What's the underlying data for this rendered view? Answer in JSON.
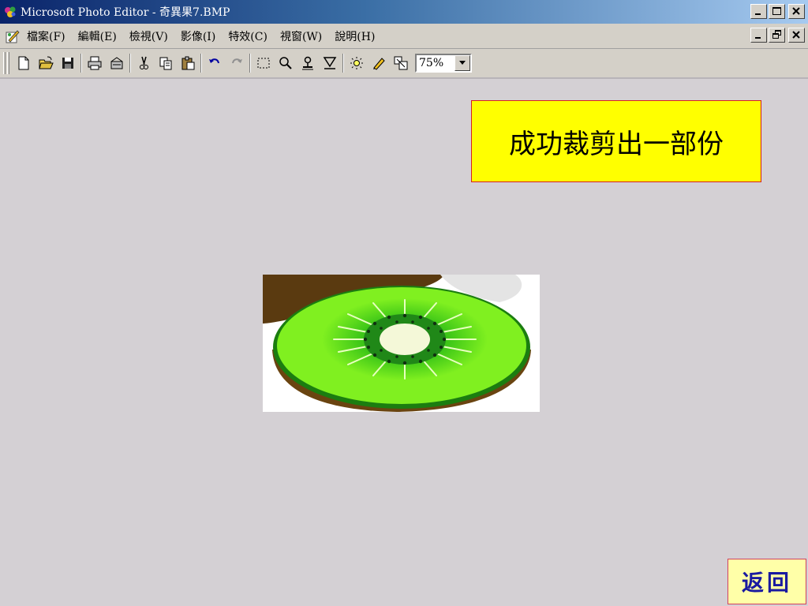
{
  "window": {
    "title": "Microsoft Photo Editor - 奇異果7.BMP"
  },
  "menu": {
    "items": [
      "檔案(F)",
      "編輯(E)",
      "檢視(V)",
      "影像(I)",
      "特效(C)",
      "視窗(W)",
      "說明(H)"
    ]
  },
  "toolbar": {
    "zoom_value": "75%"
  },
  "annotation": {
    "text": "成功裁剪出一部份"
  },
  "nav": {
    "back_label": "返回"
  },
  "colors": {
    "workspace": "#d4d0d4",
    "callout_bg": "#ffff00",
    "back_text": "#1a1aa0"
  }
}
